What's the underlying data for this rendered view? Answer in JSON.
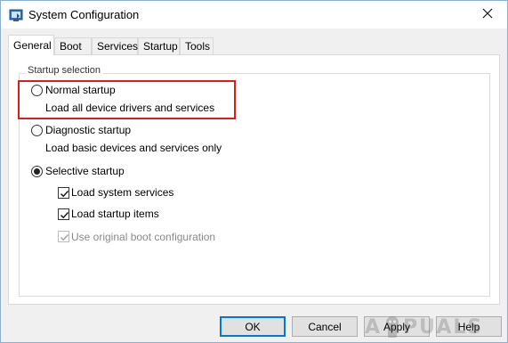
{
  "window": {
    "title": "System Configuration"
  },
  "tabs": [
    {
      "label": "General",
      "active": true
    },
    {
      "label": "Boot",
      "active": false
    },
    {
      "label": "Services",
      "active": false
    },
    {
      "label": "Startup",
      "active": false
    },
    {
      "label": "Tools",
      "active": false
    }
  ],
  "startup_selection": {
    "group_title": "Startup selection",
    "normal": {
      "label": "Normal startup",
      "description": "Load all device drivers and services",
      "selected": false
    },
    "diagnostic": {
      "label": "Diagnostic startup",
      "description": "Load basic devices and services only",
      "selected": false
    },
    "selective": {
      "label": "Selective startup",
      "selected": true,
      "options": [
        {
          "label": "Load system services",
          "checked": true,
          "enabled": true
        },
        {
          "label": "Load startup items",
          "checked": true,
          "enabled": true
        },
        {
          "label": "Use original boot configuration",
          "checked": true,
          "enabled": false
        }
      ]
    }
  },
  "buttons": {
    "ok": "OK",
    "cancel": "Cancel",
    "apply": "Apply",
    "help": "Help"
  },
  "watermark": {
    "left": "A",
    "right": "PUALS"
  },
  "colors": {
    "highlight": "#e01b1b",
    "accent": "#0078d7"
  }
}
